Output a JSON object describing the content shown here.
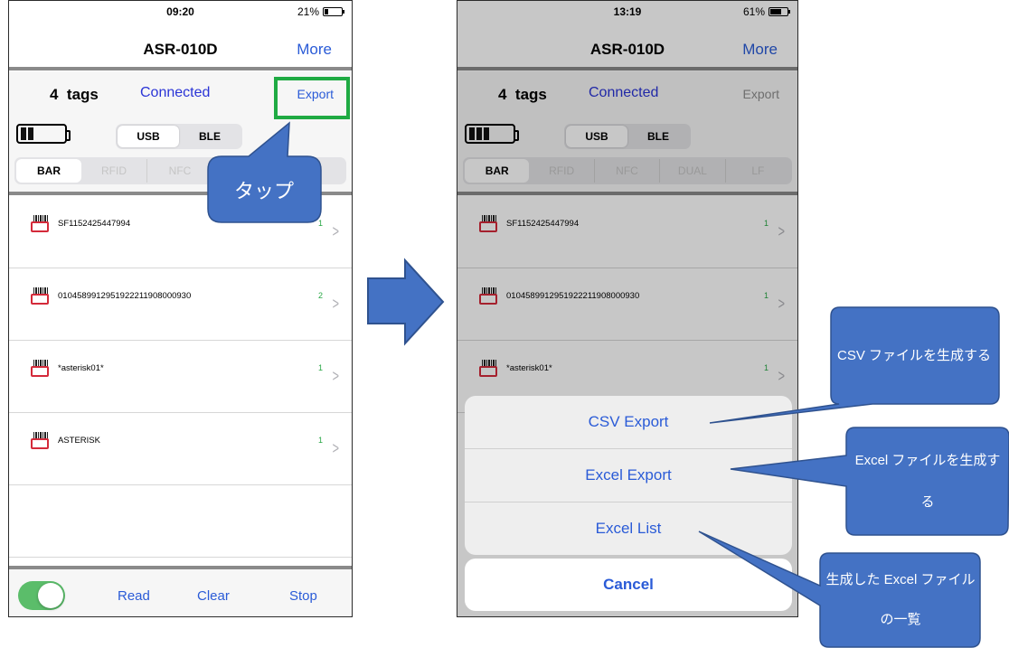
{
  "left_screen": {
    "status_time": "09:20",
    "status_battery": "21%",
    "nav_title": "ASR-010D",
    "nav_more": "More",
    "tag_count": "4",
    "tags_label": "tags",
    "connection": "Connected",
    "export_label": "Export",
    "interface_options": [
      "USB",
      "BLE"
    ],
    "selected_interface": "USB",
    "modes": [
      "BAR",
      "RFID",
      "NFC",
      "DUAL",
      "LF"
    ],
    "selected_mode": "BAR",
    "items": [
      {
        "code": "SF1152425447994",
        "count": "1"
      },
      {
        "code": "0104589912951922211908000930",
        "count": "2"
      },
      {
        "code": "*asterisk01*",
        "count": "1"
      },
      {
        "code": "ASTERISK",
        "count": "1"
      }
    ],
    "bottom": {
      "read": "Read",
      "clear": "Clear",
      "stop": "Stop"
    }
  },
  "right_screen": {
    "status_time": "13:19",
    "status_battery": "61%",
    "nav_title": "ASR-010D",
    "nav_more": "More",
    "tag_count": "4",
    "tags_label": "tags",
    "connection": "Connected",
    "export_label": "Export",
    "interface_options": [
      "USB",
      "BLE"
    ],
    "selected_interface": "USB",
    "modes": [
      "BAR",
      "RFID",
      "NFC",
      "DUAL",
      "LF"
    ],
    "selected_mode": "BAR",
    "items": [
      {
        "code": "SF1152425447994",
        "count": "1"
      },
      {
        "code": "0104589912951922211908000930",
        "count": "1"
      },
      {
        "code": "*asterisk01*",
        "count": "1"
      }
    ],
    "action_sheet": {
      "csv_export": "CSV Export",
      "excel_export": "Excel Export",
      "excel_list": "Excel List",
      "cancel": "Cancel"
    }
  },
  "annotations": {
    "tap": "タップ",
    "csv_note": "CSV ファイルを生成する",
    "excel_note": "Excel ファイルを生成する",
    "list_note": "生成した Excel ファイルの一覧"
  },
  "colors": {
    "accent_blue": "#2a5bd7",
    "callout_fill": "#4472c4",
    "callout_border": "#2f528f",
    "highlight_green": "#1faa43",
    "toggle_green": "#5bbd6a",
    "count_green": "#28a745",
    "barcode_red": "#d42a3a"
  }
}
